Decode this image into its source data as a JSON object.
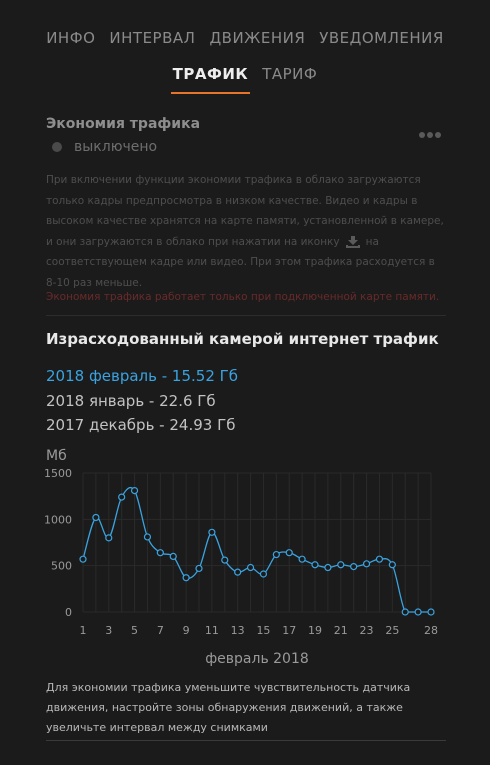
{
  "tabs": {
    "row1": [
      "ИНФО",
      "ИНТЕРВАЛ",
      "ДВИЖЕНИЯ",
      "УВЕДОМЛЕНИЯ"
    ],
    "row2": [
      "ТРАФИК",
      "ТАРИФ"
    ],
    "active": "ТРАФИК"
  },
  "saving": {
    "title": "Экономия трафика",
    "state": "выключено",
    "description_part1": "При включении функции экономии трафика в облако загружаются только кадры предпросмотра в низком качестве. Видео и кадры в высоком качестве хранятся на карте памяти, установленной в камере, и они загружаются в облако при нажатии на иконку",
    "description_part2": "на соответствующем кадре или видео. При этом трафика расходуется в 8-10 раз меньше.",
    "warning": "Экономия трафика работает только при подключенной карте памяти."
  },
  "traffic": {
    "title": "Израсходованный камерой интернет трафик",
    "months": [
      {
        "label": "2018 февраль - 15.52 Гб",
        "selected": true
      },
      {
        "label": "2018 январь - 22.6 Гб",
        "selected": false
      },
      {
        "label": "2017 декабрь - 24.93 Гб",
        "selected": false
      }
    ]
  },
  "chart_data": {
    "type": "line",
    "ylabel": "Мб",
    "xlabel": "февраль 2018",
    "ylim": [
      0,
      1500
    ],
    "yticks": [
      0,
      500,
      1000,
      1500
    ],
    "xticks": [
      1,
      3,
      5,
      7,
      9,
      11,
      13,
      15,
      17,
      19,
      21,
      23,
      25,
      28
    ],
    "xlim": [
      1,
      28
    ],
    "grid": true,
    "color": "#3aa3e0",
    "x": [
      1,
      2,
      3,
      4,
      5,
      6,
      7,
      8,
      9,
      10,
      11,
      12,
      13,
      14,
      15,
      16,
      17,
      18,
      19,
      20,
      21,
      22,
      23,
      24,
      25,
      26,
      27,
      28
    ],
    "values": [
      570,
      1020,
      800,
      1240,
      1310,
      810,
      640,
      600,
      370,
      470,
      860,
      560,
      430,
      480,
      410,
      620,
      640,
      570,
      510,
      480,
      510,
      490,
      520,
      570,
      510,
      0,
      0,
      0
    ]
  },
  "hint": "Для экономии трафика уменьшите чувствительность датчика движения, настройте зоны обнаружения движений, а также увеличьте интервал между снимками"
}
